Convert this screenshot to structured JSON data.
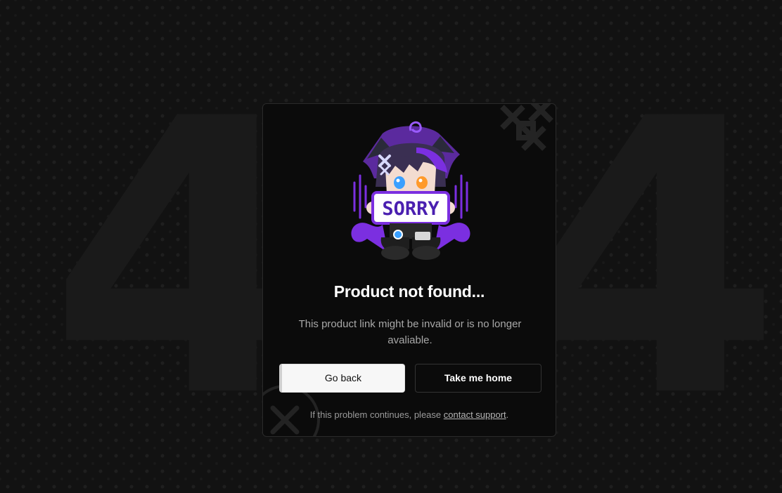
{
  "background": {
    "digit_left": "4",
    "digit_right": "4"
  },
  "mascot": {
    "sign_text": "SORRY"
  },
  "error": {
    "title": "Product not found...",
    "message": "This product link might be invalid or is no longer avaliable."
  },
  "actions": {
    "back_label": "Go back",
    "home_label": "Take me home"
  },
  "footer": {
    "prefix": "If this problem continues, please ",
    "link_label": "contact support",
    "suffix": "."
  },
  "colors": {
    "page_bg": "#121212",
    "card_bg": "#0b0b0b",
    "accent_purple": "#7b2fe0",
    "text_primary": "#ffffff",
    "text_muted": "#a8a8a8"
  }
}
